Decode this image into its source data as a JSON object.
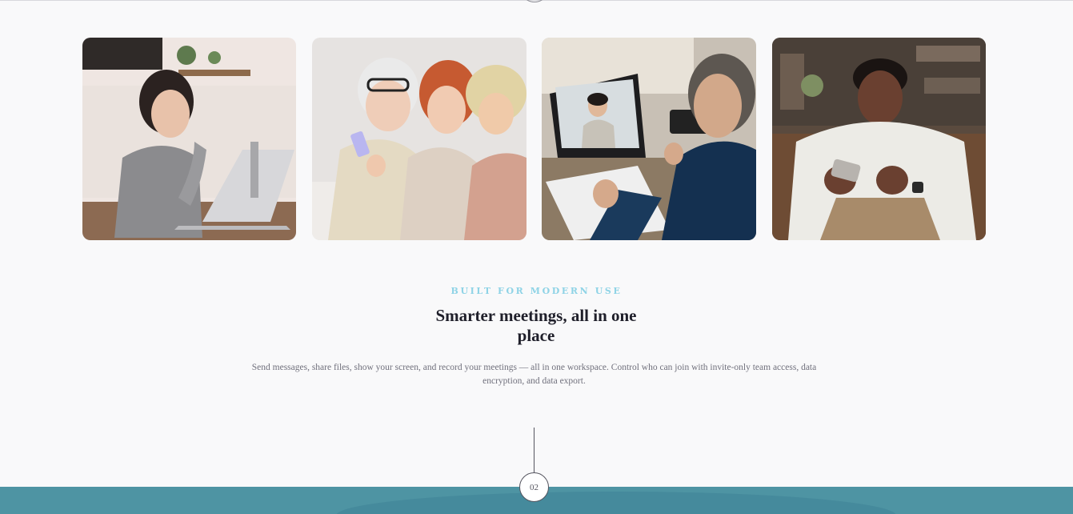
{
  "section": {
    "eyebrow": "BUILT FOR MODERN USE",
    "headline": "Smarter meetings, all in one place",
    "description": "Send messages, share files, show your screen, and record your meetings — all in one workspace. Control who can join with invite-only team access, data encryption, and data export."
  },
  "step": {
    "number": "02"
  },
  "colors": {
    "background": "#f9f9fa",
    "eyebrow": "#8ed3e6",
    "headline": "#1f1f2a",
    "body_text": "#70707c",
    "band": "#4e94a3"
  }
}
